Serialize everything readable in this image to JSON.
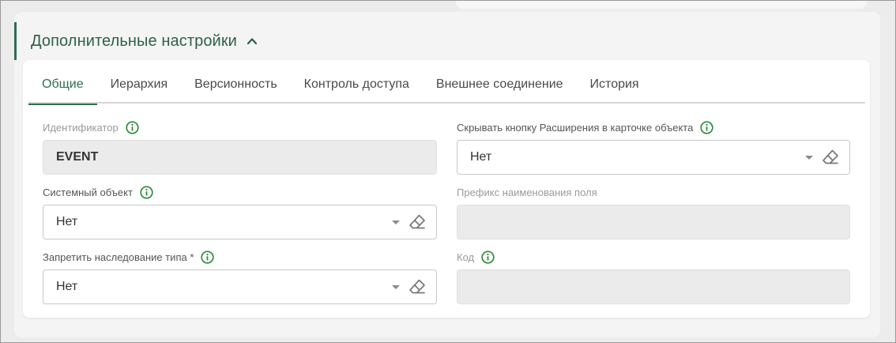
{
  "section": {
    "title": "Дополнительные настройки"
  },
  "tabs": [
    {
      "label": "Общие",
      "active": true
    },
    {
      "label": "Иерархия",
      "active": false
    },
    {
      "label": "Версионность",
      "active": false
    },
    {
      "label": "Контроль доступа",
      "active": false
    },
    {
      "label": "Внешнее соединение",
      "active": false
    },
    {
      "label": "История",
      "active": false
    }
  ],
  "fields": {
    "identifier": {
      "label": "Идентификатор",
      "value": "EVENT"
    },
    "system_object": {
      "label": "Системный объект",
      "value": "Нет"
    },
    "forbid_inheritance": {
      "label": "Запретить наследование типа *",
      "value": "Нет"
    },
    "hide_extension_button": {
      "label": "Скрывать кнопку Расширения в карточке объекта",
      "value": "Нет"
    },
    "field_name_prefix": {
      "label": "Префикс наименования поля",
      "value": ""
    },
    "code": {
      "label": "Код",
      "value": ""
    }
  },
  "colors": {
    "accent": "#2d6e4f",
    "info_icon": "#2e8b3a"
  }
}
